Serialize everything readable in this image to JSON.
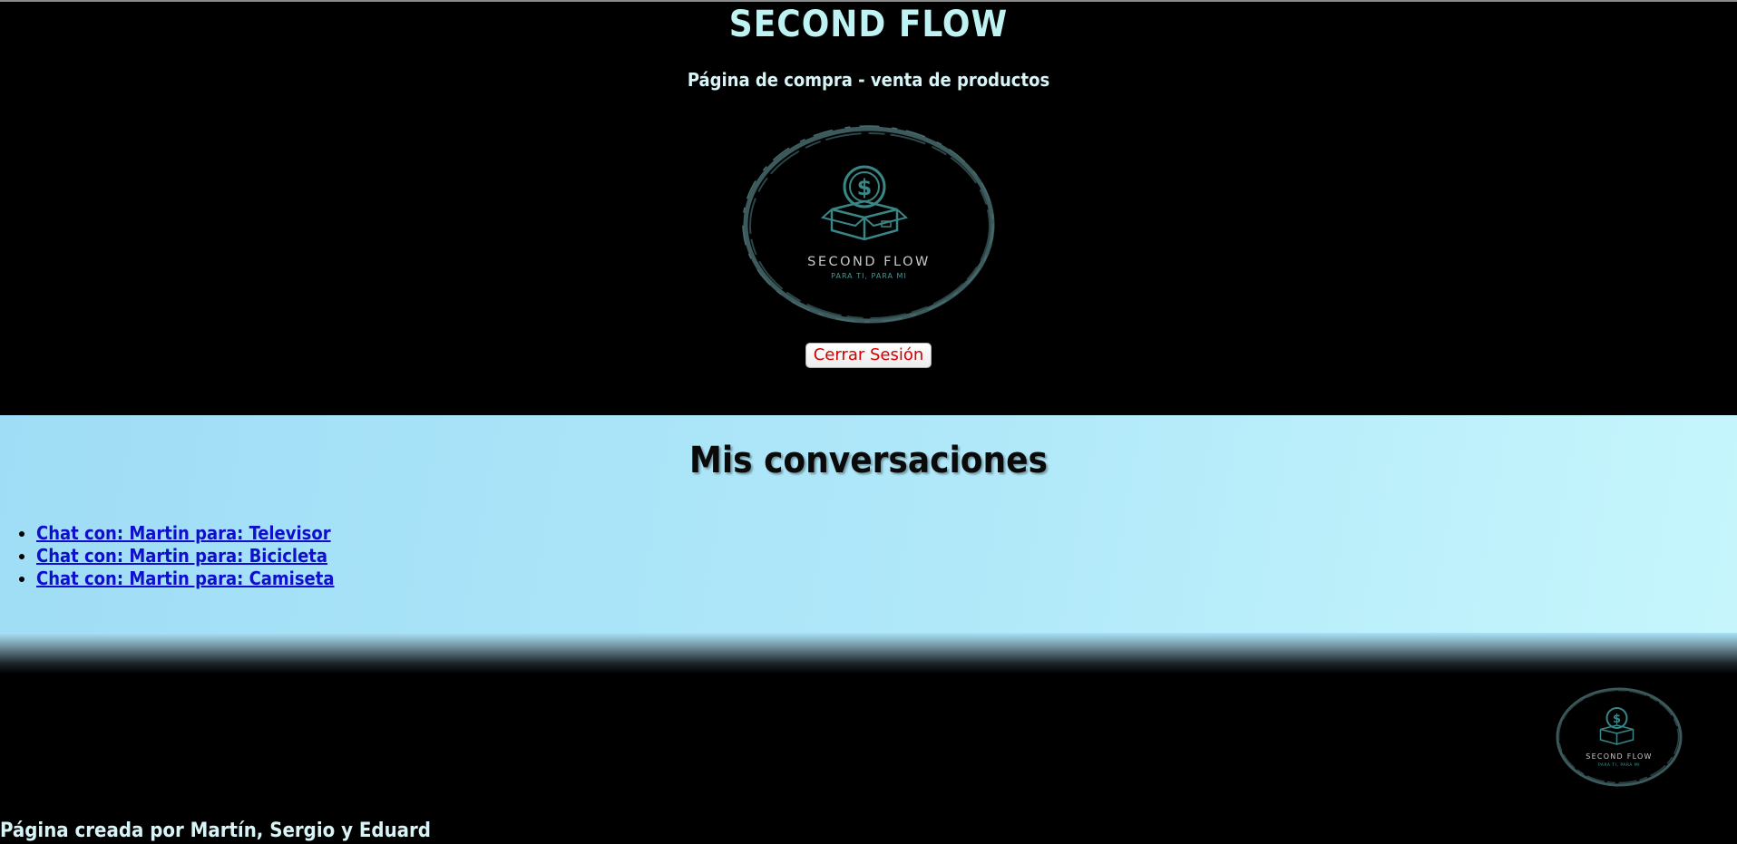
{
  "header": {
    "title": "SECOND FLOW",
    "subtitle": "Página de compra - venta de productos",
    "logout_label": "Cerrar Sesión"
  },
  "logo": {
    "brand": "SECOND FLOW",
    "tagline": "PARA TI, PARA MI",
    "icon": "money-box-icon"
  },
  "conversations": {
    "title": "Mis conversaciones",
    "items": [
      {
        "label": "Chat con: Martin para: Televisor"
      },
      {
        "label": "Chat con: Martin para: Bicicleta"
      },
      {
        "label": "Chat con: Martin para: Camiseta"
      }
    ]
  },
  "footer": {
    "credit": "Página creada por Martín, Sergio y Eduard"
  },
  "colors": {
    "title_text": "#bff3f3",
    "logout_text": "#d40000",
    "link": "#1010cc",
    "panel_gradient_start": "#9fddf6",
    "panel_gradient_end": "#c6f6fc",
    "logo_teal": "#3a7f7f"
  }
}
